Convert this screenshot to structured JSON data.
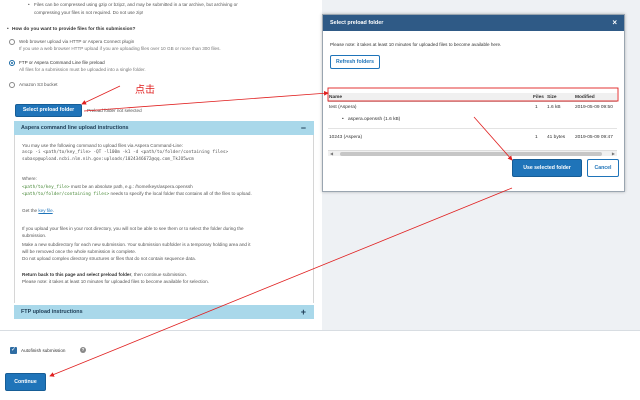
{
  "top_lines": {
    "line1": "Files can be compressed using gzip or bzip2, and may be submitted in a tar archive, but archiving or",
    "line2": "compressing your files is not required. Do not use zip!"
  },
  "question": "How do you want to provide files for this submission?",
  "options": [
    {
      "label": "Web browser upload via HTTP or Aspera Connect plugin",
      "desc": "If you use a web browser HTTP upload if you are uploading files over 10 GB or more than 300 files.",
      "checked": false
    },
    {
      "label": "FTP or Aspera Command Line file preload",
      "desc": "All files for a submission must be uploaded into a single folder.",
      "checked": true
    },
    {
      "label": "Amazon S3 bucket",
      "desc": "",
      "checked": false
    }
  ],
  "annotation_click": "点击",
  "select_preload_button": "Select preload folder",
  "preload_status": "Preload folder not selected",
  "aspera_header": "Aspera command line upload instructions",
  "aspera_sign": "−",
  "instructions": {
    "intro": "You may use the following command to upload files via Aspera Command-Line:",
    "cmd1": "ascp -i <path/to/key_file> -QT -l100m -k1 -d <path/to/folder/containing files>",
    "cmd2": "subasp@upload.ncbi.nlm.nih.gov:uploads/1024346672@qq.com_TkJO5wcm",
    "where": "Where:",
    "key_path": "<path/to/key_file>",
    "key_text": " must be an absolute path, e.g.: /home/keys/aspera.openssh",
    "folder_path": "<path/to/folder/containing files>",
    "folder_text": " needs to specify the local folder that contains all of the files to upload.",
    "get_key_prefix": "Get the ",
    "get_key_link": "key file",
    "get_key_suffix": ".",
    "root1": "If you upload your files in your root directory, you will not be able to see them or to select the folder during the",
    "root2": "submission.",
    "sub1": "Make a new subdirectory for each new submission. Your submission subfolder is a temporary holding area and it",
    "sub2": "will be removed once the whole submission is complete.",
    "sub3": "Do not upload complex directory structures or files that do not contain sequence data.",
    "return1": "Return back to this page and select preload folder",
    "return2": ", then continue submission.",
    "note": "Please note: it takes at least 10 minutes for uploaded files to become available for selection."
  },
  "ftp_header": "FTP upload instructions",
  "ftp_sign": "+",
  "autofinish_label": "Autofinish submission",
  "help_icon": "?",
  "continue_button": "Continue",
  "dialog": {
    "title": "Select preload folder",
    "close": "×",
    "note": "Please note: it takes at least 10 minutes for uploaded files to become available here.",
    "refresh_button": "Refresh folders",
    "columns": [
      "Name",
      "Files",
      "Size",
      "Modified"
    ],
    "rows": [
      {
        "name": "test (Aspera)",
        "files": "1",
        "size": "1.6 kB",
        "modified": "2019-05-09 09:50"
      },
      {
        "name": "aspera.openssh (1.6 kB)",
        "files": "",
        "size": "",
        "modified": ""
      },
      {
        "name": "10243 (Aspera)",
        "files": "1",
        "size": "41 bytes",
        "modified": "2019-05-09 09:47"
      }
    ],
    "use_button": "Use selected folder",
    "cancel_button": "Cancel"
  },
  "colors": {
    "primary": "#1f74b9",
    "accordion": "#a9d8ea",
    "dialog_header": "#2f5a86",
    "annotation": "#e02020"
  }
}
